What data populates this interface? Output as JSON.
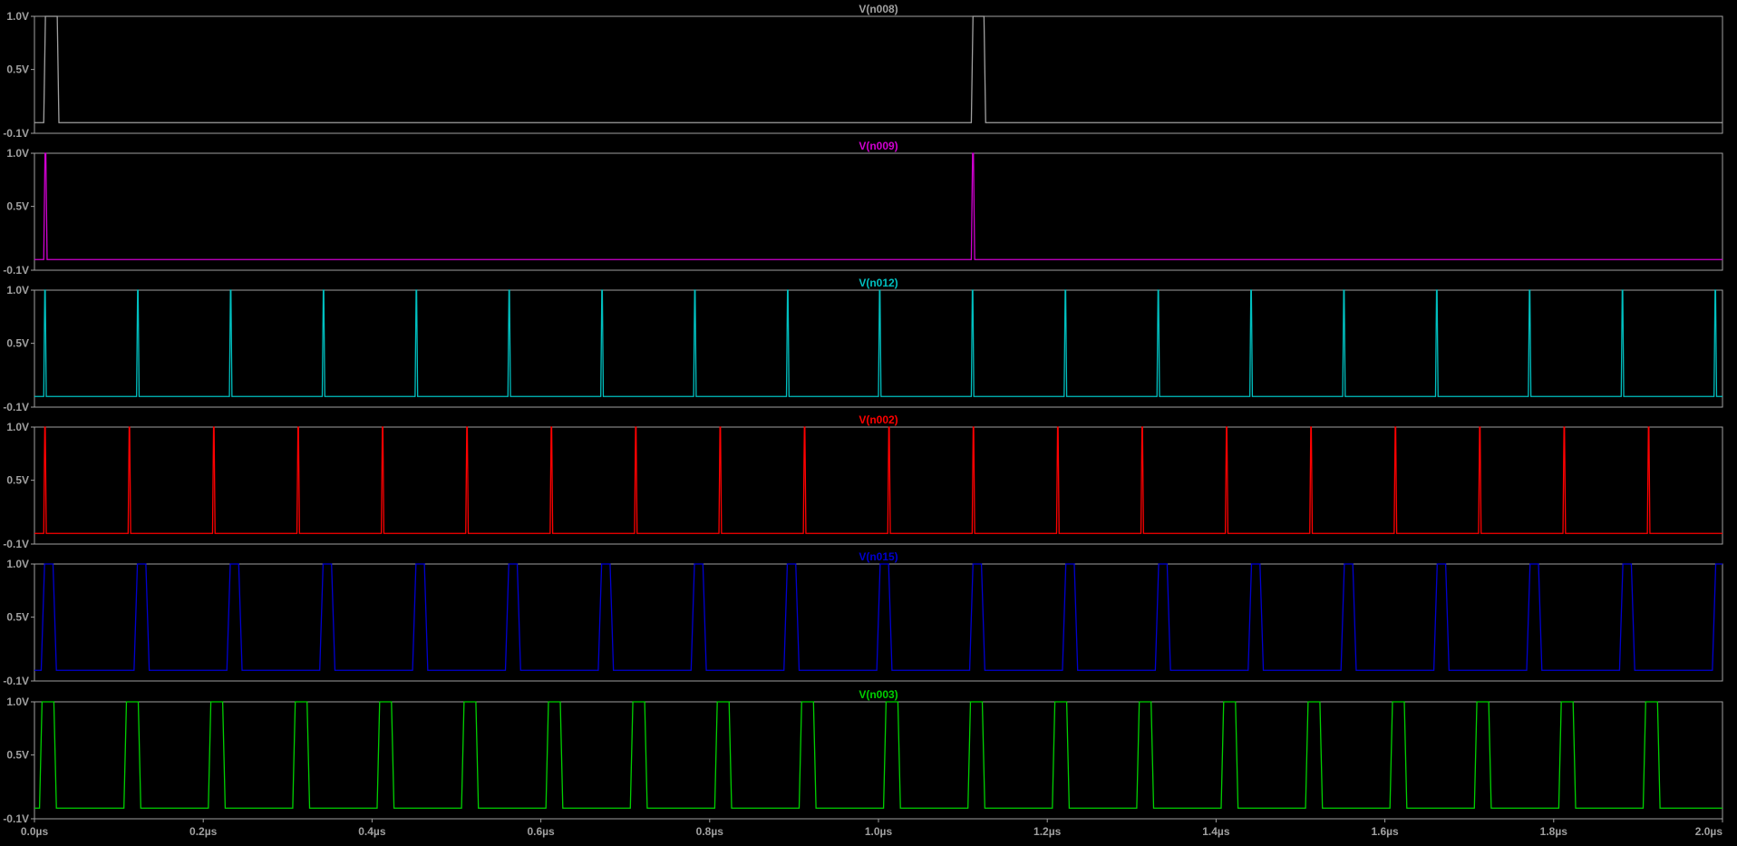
{
  "chart_data": {
    "type": "line",
    "x_unit": "µs",
    "xlim": [
      0,
      2.0
    ],
    "x_ticks": [
      "0.0µs",
      "0.2µs",
      "0.4µs",
      "0.6µs",
      "0.8µs",
      "1.0µs",
      "1.2µs",
      "1.4µs",
      "1.6µs",
      "1.8µs",
      "2.0µs"
    ],
    "x_tick_values": [
      0,
      0.2,
      0.4,
      0.6,
      0.8,
      1.0,
      1.2,
      1.4,
      1.6,
      1.8,
      2.0
    ],
    "ylim": [
      -0.1,
      1.0
    ],
    "y_ticks": [
      "1.0V",
      "0.5V",
      "-0.1V"
    ],
    "y_tick_values": [
      1.0,
      0.5,
      -0.1
    ],
    "grid": false,
    "panes": [
      {
        "name": "V(n008)",
        "color": "#a0a0a0",
        "low": 0.0,
        "high": 1.0,
        "points": [
          [
            0,
            0.0
          ],
          [
            0.011,
            0.0
          ],
          [
            0.013,
            1.0
          ],
          [
            0.027,
            1.0
          ],
          [
            0.029,
            0.0
          ],
          [
            1.11,
            0.0
          ],
          [
            1.112,
            1.0
          ],
          [
            1.125,
            1.0
          ],
          [
            1.127,
            0.0
          ],
          [
            2.0,
            0.0
          ]
        ]
      },
      {
        "name": "V(n009)",
        "color": "#d000d0",
        "low": 0.0,
        "high": 1.0,
        "points": [
          [
            0,
            0.0
          ],
          [
            0.011,
            0.0
          ],
          [
            0.0125,
            1.0
          ],
          [
            0.0135,
            1.0
          ],
          [
            0.015,
            0.0
          ],
          [
            1.11,
            0.0
          ],
          [
            1.1115,
            1.0
          ],
          [
            1.1125,
            1.0
          ],
          [
            1.114,
            0.0
          ],
          [
            2.0,
            0.0
          ]
        ]
      },
      {
        "name": "V(n012)",
        "color": "#00c0c0",
        "spikes": {
          "low": 0.0,
          "high": 1.0,
          "width": 0.003,
          "times": [
            0.011,
            0.121,
            0.231,
            0.341,
            0.451,
            0.561,
            0.671,
            0.781,
            0.891,
            1.0,
            1.11,
            1.22,
            1.33,
            1.44,
            1.55,
            1.66,
            1.77,
            1.88,
            1.99
          ]
        }
      },
      {
        "name": "V(n002)",
        "color": "#ff0000",
        "spikes": {
          "low": 0.0,
          "high": 1.0,
          "width": 0.003,
          "times": [
            0.011,
            0.111,
            0.211,
            0.311,
            0.411,
            0.511,
            0.611,
            0.711,
            0.811,
            0.911,
            1.011,
            1.111,
            1.211,
            1.311,
            1.411,
            1.511,
            1.611,
            1.711,
            1.811,
            1.911
          ]
        }
      },
      {
        "name": "V(n015)",
        "color": "#0000d0",
        "pulses": {
          "low": 0.0,
          "high": 1.0,
          "rise": 0.004,
          "width": 0.01,
          "first_start": 0.008,
          "period": 0.11,
          "count": 19
        }
      },
      {
        "name": "V(n003)",
        "color": "#00d000",
        "pulses": {
          "low": 0.0,
          "high": 1.0,
          "rise": 0.003,
          "width": 0.014,
          "first_start": 0.006,
          "period": 0.1,
          "count": 20
        }
      }
    ]
  }
}
